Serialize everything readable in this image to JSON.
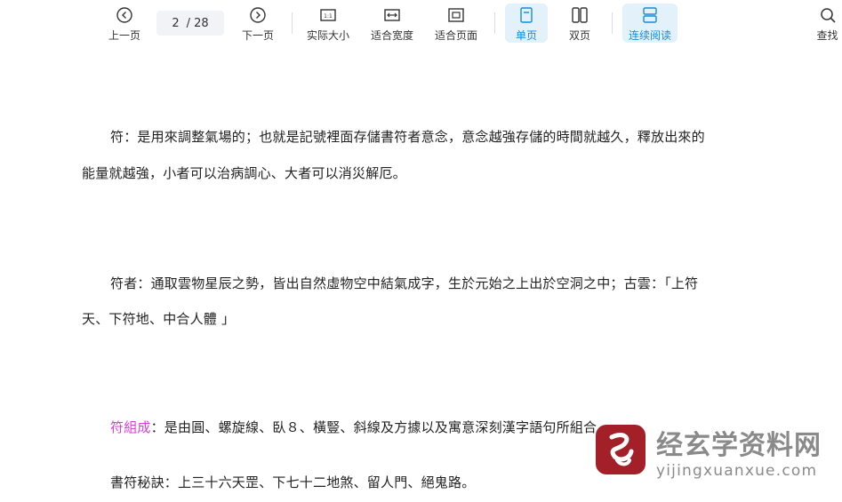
{
  "toolbar": {
    "prev_label": "上一页",
    "page_current": "2",
    "page_total": "/ 28",
    "next_label": "下一页",
    "actual_size_label": "实际大小",
    "fit_width_label": "适合宽度",
    "fit_page_label": "适合页面",
    "single_page_label": "单页",
    "double_page_label": "双页",
    "continuous_label": "连续阅读",
    "search_label": "查找",
    "active_color": "#1a8ad6"
  },
  "document": {
    "para1_line1": "符：是用來調整氣場的；也就是記號裡面存儲書符者意念，意念越強存儲的時間就越久，釋放出來的",
    "para1_line2": "能量就越強，小者可以治病調心、大者可以消災解厄。",
    "para2_line1": "符者：通取雲物星辰之勢，皆出自然虛物空中結氣成字，生於元始之上出於空洞之中；古雲：「上符",
    "para2_line2": "天、下符地、中合人體 」",
    "para3_term": "符組成",
    "para3_rest": "：是由圓、螺旋線、臥８、橫豎、斜線及方據以及寓意深刻漢字語句所組合。",
    "para4": "書符秘訣：上三十六天罡、下七十二地煞、留人門、絕鬼路。",
    "highlight_color": "#d63fd0"
  },
  "watermark": {
    "title": "经玄学资料网",
    "url": "yijingxuanxue.com"
  }
}
